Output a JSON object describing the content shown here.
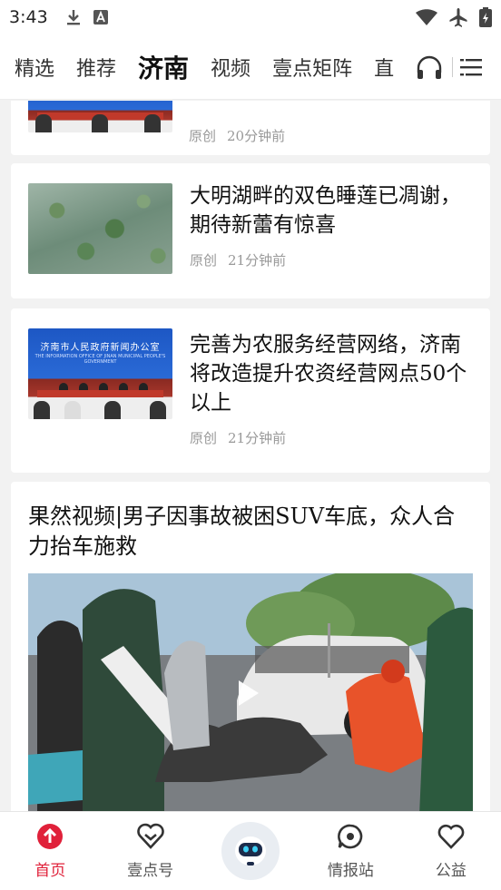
{
  "status_bar": {
    "time": "3:43",
    "left_icons": [
      "download-icon",
      "a-box-icon"
    ],
    "right_icons": [
      "wifi-icon",
      "airplane-icon",
      "battery-icon"
    ]
  },
  "top_nav": {
    "tabs": [
      {
        "label": "精选",
        "active": false
      },
      {
        "label": "推荐",
        "active": false
      },
      {
        "label": "济南",
        "active": true
      },
      {
        "label": "视频",
        "active": false
      },
      {
        "label": "壹点矩阵",
        "active": false
      },
      {
        "label": "直",
        "active": false
      }
    ],
    "icons": [
      "headphones-icon",
      "menu-icon"
    ]
  },
  "feed": {
    "partial_card": {
      "meta_source": "原创",
      "meta_time": "20分钟前"
    },
    "cards": [
      {
        "title": "大明湖畔的双色睡莲已凋谢，期待新蕾有惊喜",
        "source": "原创",
        "time": "21分钟前"
      },
      {
        "title": "完善为农服务经营网络，济南将改造提升农资经营网点50个以上",
        "source": "原创",
        "time": "21分钟前",
        "thumb_banner": "济南市人民政府新闻办公室",
        "thumb_sub": "THE INFORMATION OFFICE OF JINAN MUNICIPAL PEOPLE'S GOVERNMENT"
      }
    ],
    "video_card": {
      "title": "果然视频|男子因事故被困SUV车底，众人合力抬车施救"
    }
  },
  "bottom_nav": {
    "items": [
      {
        "label": "首页",
        "icon": "home-up-arrow-icon",
        "active": true
      },
      {
        "label": "壹点号",
        "icon": "heart-chevron-icon",
        "active": false
      },
      {
        "label": "",
        "icon": "robot-icon",
        "active": false
      },
      {
        "label": "情报站",
        "icon": "chat-target-icon",
        "active": false
      },
      {
        "label": "公益",
        "icon": "heart-icon",
        "active": false
      }
    ]
  },
  "colors": {
    "accent": "#e0213a",
    "background": "#f2f2f2"
  }
}
